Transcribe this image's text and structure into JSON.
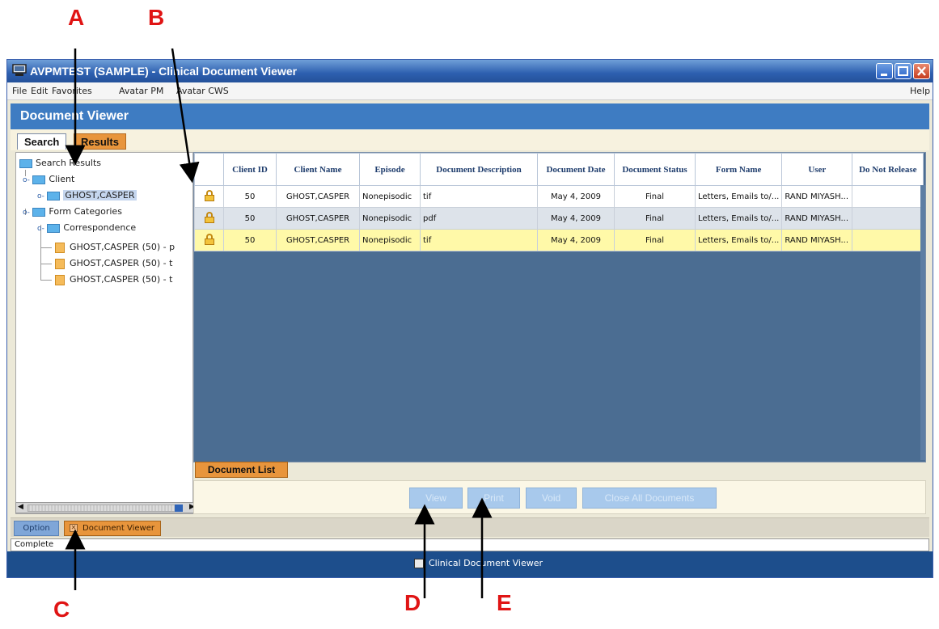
{
  "annotations": {
    "a": "A",
    "b": "B",
    "c": "C",
    "d": "D",
    "e": "E"
  },
  "window": {
    "title": "AVPMTEST (SAMPLE) - Clinical Document Viewer"
  },
  "menu": {
    "file": "File",
    "edit": "Edit",
    "favorites": "Favorites",
    "avatar_pm": "Avatar PM",
    "avatar_cws": "Avatar CWS",
    "help": "Help"
  },
  "header": {
    "title": "Document Viewer"
  },
  "tabs": {
    "search": "Search",
    "results": "Results"
  },
  "tree": {
    "root": "Search Results",
    "client": "Client",
    "client_name": "GHOST,CASPER",
    "form_categories": "Form Categories",
    "correspondence": "Correspondence",
    "docs": [
      "GHOST,CASPER (50) - p",
      "GHOST,CASPER (50) - t",
      "GHOST,CASPER (50) - t"
    ]
  },
  "grid": {
    "columns": [
      "",
      "Client ID",
      "Client Name",
      "Episode",
      "Document Description",
      "Document Date",
      "Document Status",
      "Form Name",
      "User",
      "Do Not Release"
    ],
    "rows": [
      [
        "",
        "50",
        "GHOST,CASPER",
        "Nonepisodic",
        "tif",
        "May 4, 2009",
        "Final",
        "Letters, Emails to/...",
        "RAND MIYASH...",
        ""
      ],
      [
        "",
        "50",
        "GHOST,CASPER",
        "Nonepisodic",
        "pdf",
        "May 4, 2009",
        "Final",
        "Letters, Emails to/...",
        "RAND MIYASH...",
        ""
      ],
      [
        "",
        "50",
        "GHOST,CASPER",
        "Nonepisodic",
        "tif",
        "May 4, 2009",
        "Final",
        "Letters, Emails to/...",
        "RAND MIYASH...",
        ""
      ]
    ]
  },
  "document_list_tab": "Document List",
  "buttons": {
    "view": "View",
    "print": "Print",
    "void": "Void",
    "close_all": "Close All Documents"
  },
  "bottom_tabs": {
    "option": "Option",
    "document_viewer": "Document Viewer"
  },
  "status": "Complete",
  "taskbar": {
    "label": "Clinical Document Viewer"
  }
}
